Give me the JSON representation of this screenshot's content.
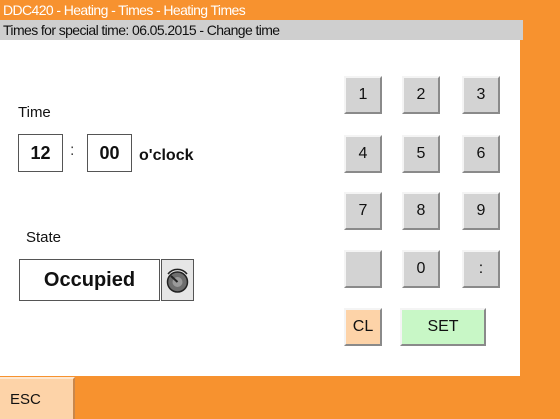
{
  "window": {
    "title": "DDC420 - Heating - Times - Heating Times",
    "subtitle": "Times for special time: 06.05.2015 - Change time"
  },
  "time": {
    "label": "Time",
    "hour": "12",
    "separator": ":",
    "minute": "00",
    "unit": "o'clock"
  },
  "state": {
    "label": "State",
    "value": "Occupied",
    "toggle_icon": "rotary-knob-icon"
  },
  "keypad": {
    "keys": [
      "1",
      "2",
      "3",
      "4",
      "5",
      "6",
      "7",
      "8",
      "9",
      "",
      "0",
      ":"
    ],
    "clear_label": "CL",
    "set_label": "SET"
  },
  "footer": {
    "esc_label": "ESC"
  },
  "colors": {
    "frame": "#f7922f",
    "subtitle_bg": "#cfcfcf",
    "key_bg": "#d3d3d3",
    "clear_bg": "#fdd3a8",
    "set_bg": "#c8f7c6"
  }
}
